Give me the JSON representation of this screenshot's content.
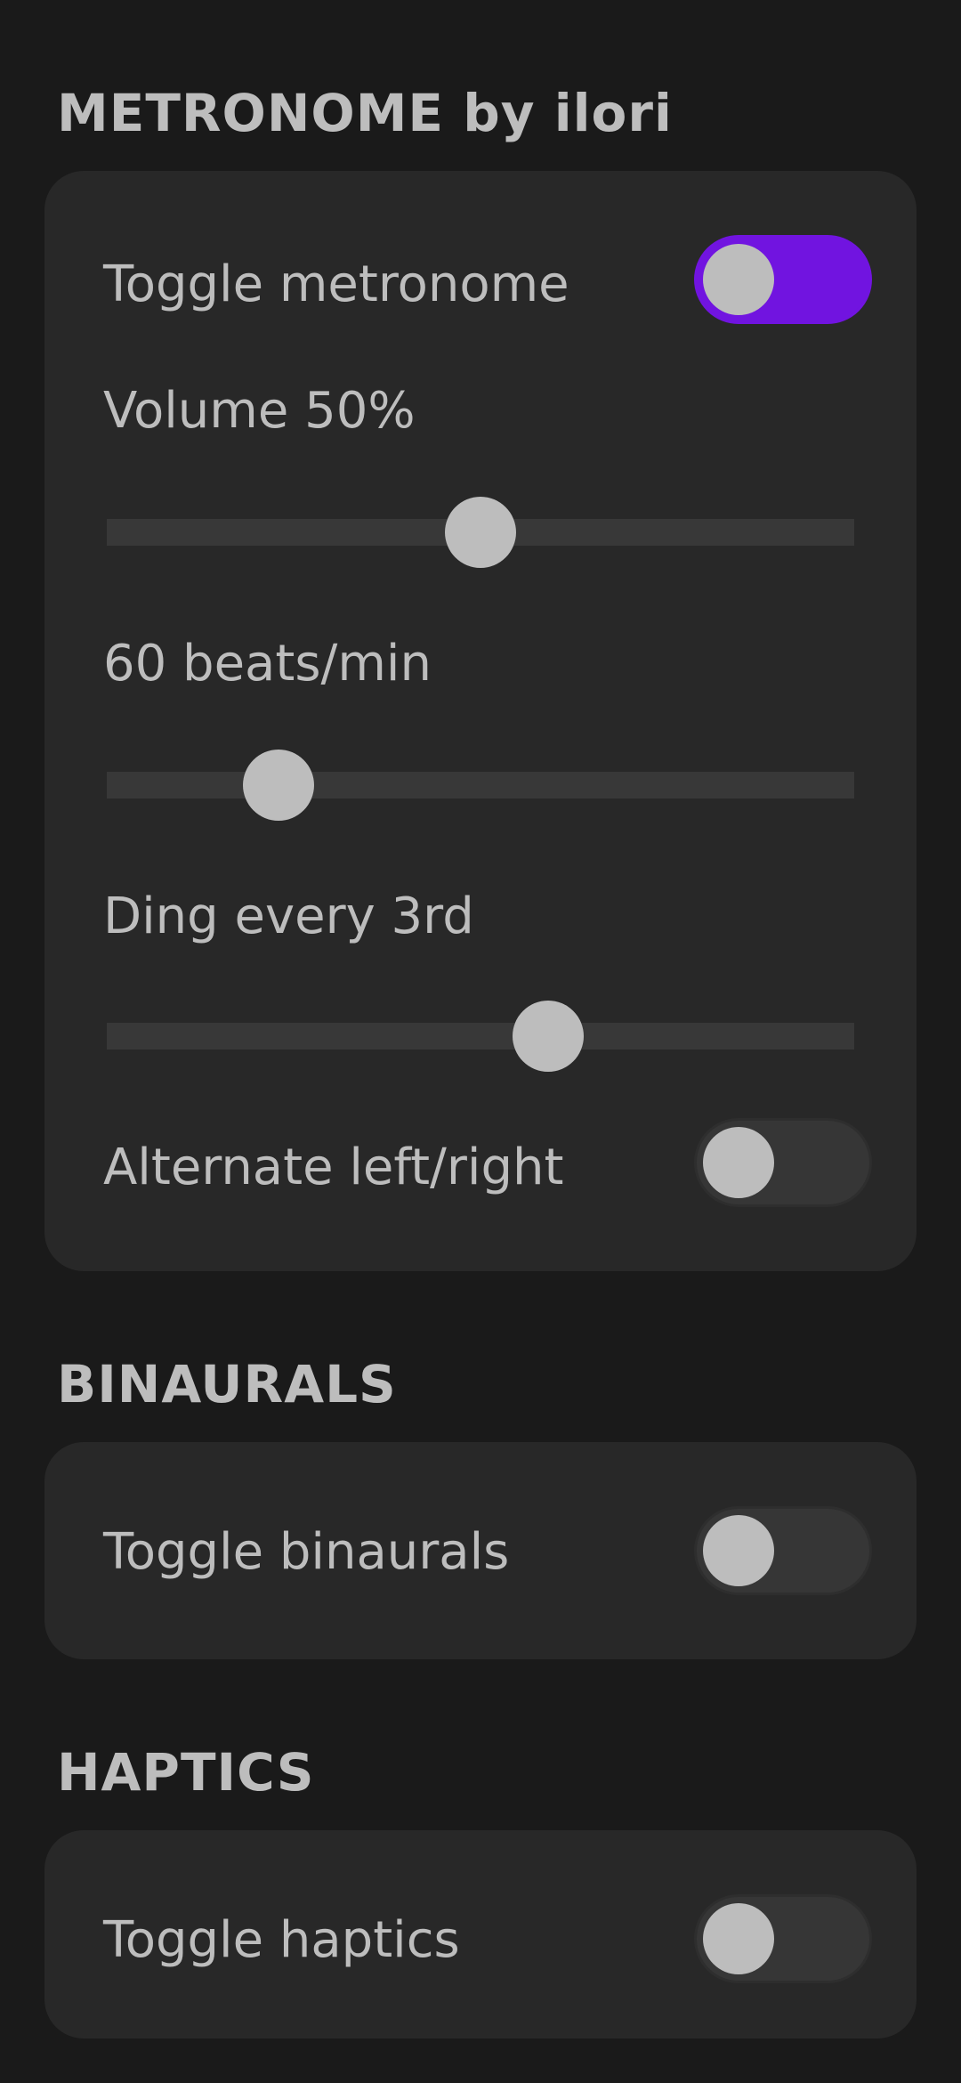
{
  "metronome": {
    "title": "METRONOME by ilori",
    "toggle_label": "Toggle metronome",
    "toggle_on": true,
    "volume_label": "Volume 50%",
    "volume_value": 0.5,
    "bpm_label": "60 beats/min",
    "bpm_value": 0.23,
    "ding_label": "Ding every 3rd",
    "ding_value": 0.59,
    "alternate_label": "Alternate left/right",
    "alternate_on": false
  },
  "binaurals": {
    "title": "BINAURALS",
    "toggle_label": "Toggle binaurals",
    "toggle_on": false
  },
  "haptics": {
    "title": "HAPTICS",
    "toggle_label": "Toggle haptics",
    "toggle_on": false
  },
  "colors": {
    "background": "#1a1a1a",
    "card": "#282828",
    "accent": "#7114e0",
    "text": "#bdbdbd",
    "track": "#383838",
    "toggle_off": "#363636"
  }
}
